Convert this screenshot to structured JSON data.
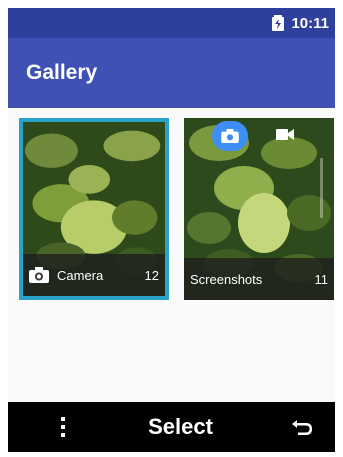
{
  "status": {
    "time": "10:11",
    "battery_icon": "battery-charging-icon"
  },
  "appbar": {
    "title": "Gallery"
  },
  "albums": [
    {
      "name": "Camera",
      "count": "12",
      "icon": "camera-icon",
      "selected": true
    },
    {
      "name": "Screenshots",
      "count": "11",
      "icons": [
        "camera-chip-icon",
        "video-icon"
      ]
    }
  ],
  "softkeys": {
    "left_icon": "menu-dots-icon",
    "center_label": "Select",
    "right_icon": "back-icon"
  },
  "colors": {
    "statusbar": "#2e3f9c",
    "appbar": "#3f51b5",
    "selection": "#29a3c9",
    "chip": "#3e8ef7"
  }
}
